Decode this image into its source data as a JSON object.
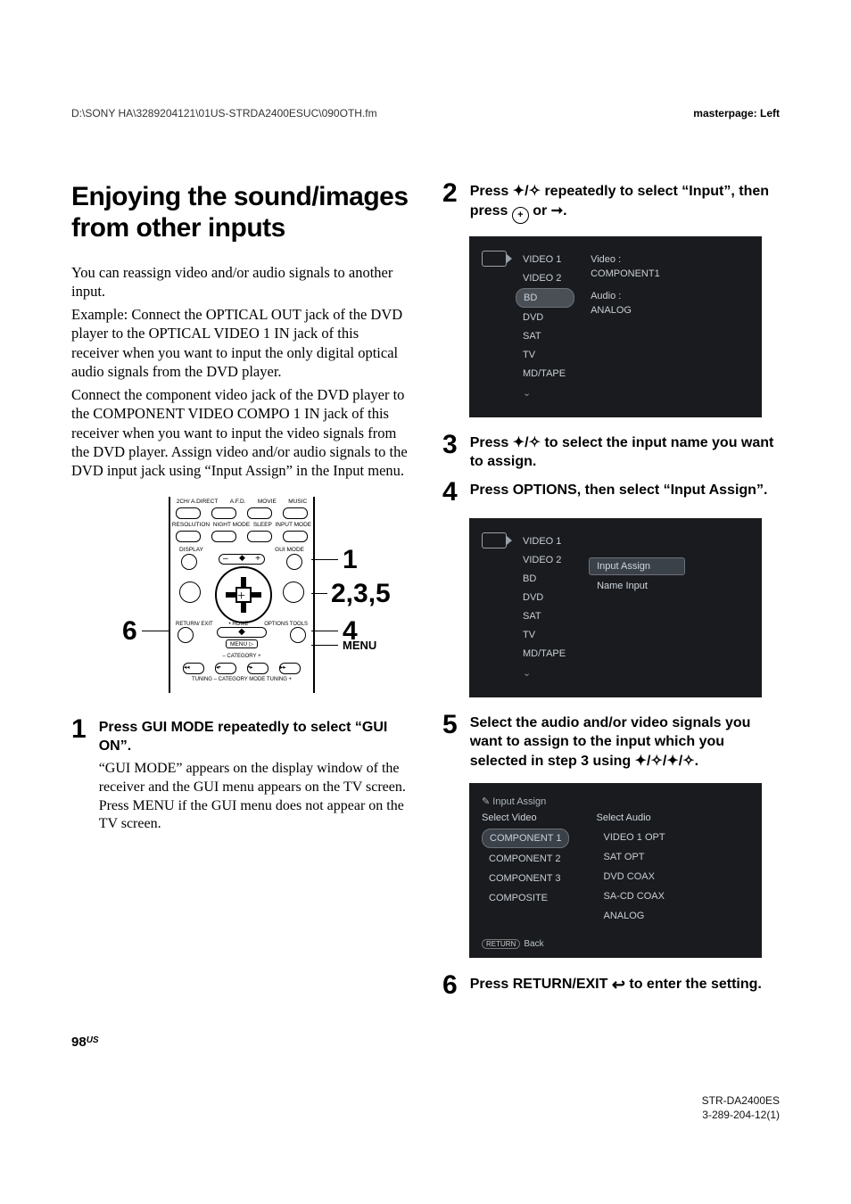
{
  "header": {
    "path": "D:\\SONY HA\\3289204121\\01US-STRDA2400ESUC\\090OTH.fm",
    "masterpage": "masterpage: Left"
  },
  "title": "Enjoying the sound/images from other inputs",
  "intro": {
    "p1": "You can reassign video and/or audio signals to another input.",
    "p2": "Example: Connect the OPTICAL OUT jack of the DVD player to the OPTICAL VIDEO 1 IN jack of this receiver when you want to input the only digital optical audio signals from the DVD player.",
    "p3": "Connect the component video jack of the DVD player to the COMPONENT VIDEO COMPO 1 IN jack of this receiver when you want to input the video signals from the DVD player. Assign video and/or audio signals to the DVD input jack using “Input Assign” in the Input menu."
  },
  "remote": {
    "callout_1": "1",
    "callout_235": "2,3,5",
    "callout_6": "6",
    "callout_4": "4",
    "callout_menu": "MENU",
    "labels_top": [
      "2CH/\nA.DIRECT",
      "A.F.D.",
      "MOVIE",
      "MUSIC"
    ],
    "labels_row2": [
      "RESOLUTION",
      "NIGHT\nMODE",
      "SLEEP",
      "INPUT\nMODE"
    ],
    "labels_misc": [
      "DISPLAY",
      "GUI\nMODE"
    ],
    "labels_bottom_left": "RETURN/\nEXIT",
    "labels_bottom_home": "HOME",
    "labels_bottom_menu": "MENU",
    "labels_bottom_options": "OPTIONS\nTOOLS",
    "labels_cat": "CATEGORY",
    "labels_tuning": "TUNING – CATEGORY MODE TUNING +"
  },
  "steps": {
    "s1": {
      "num": "1",
      "head": "Press GUI MODE repeatedly to select “GUI ON”.",
      "desc": "“GUI MODE” appears on the display window of the receiver and the GUI menu appears on the TV screen.  Press MENU if the GUI menu does not appear on the TV screen."
    },
    "s2": {
      "num": "2",
      "head_a": "Press ",
      "head_b": " repeatedly to select “Input”, then press ",
      "head_c": " or ",
      "head_end": "."
    },
    "s3": {
      "num": "3",
      "head_a": "Press ",
      "head_b": " to select the input name you want to assign."
    },
    "s4": {
      "num": "4",
      "head": "Press OPTIONS, then select “Input Assign”."
    },
    "s5": {
      "num": "5",
      "head_a": "Select the audio and/or video signals you want to assign to the input which you selected in step 3 using ",
      "head_end": "."
    },
    "s6": {
      "num": "6",
      "head_a": "Press RETURN/EXIT ",
      "head_b": " to enter the setting."
    }
  },
  "gui1": {
    "items": [
      "VIDEO 1",
      "VIDEO 2",
      "BD",
      "DVD",
      "SAT",
      "TV",
      "MD/TAPE"
    ],
    "selected": "BD",
    "right_video_label": "Video :",
    "right_video_val": "COMPONENT1",
    "right_audio_label": "Audio :",
    "right_audio_val": "ANALOG"
  },
  "gui2": {
    "items": [
      "VIDEO 1",
      "VIDEO 2",
      "BD",
      "DVD",
      "SAT",
      "TV",
      "MD/TAPE"
    ],
    "opt1": "Input Assign",
    "opt2": "Name Input"
  },
  "gui3": {
    "title": "Input Assign",
    "video_h": "Select Video",
    "audio_h": "Select Audio",
    "video": [
      "COMPONENT 1",
      "COMPONENT 2",
      "COMPONENT 3",
      "COMPOSITE"
    ],
    "video_sel": "COMPONENT 1",
    "audio": [
      "VIDEO 1 OPT",
      "SAT OPT",
      "DVD COAX",
      "SA-CD COAX",
      "ANALOG"
    ],
    "back_btn": "RETURN",
    "back": "Back"
  },
  "footer": {
    "page": "98",
    "region": "US",
    "model": "STR-DA2400ES",
    "doc": "3-289-204-12(1)"
  }
}
